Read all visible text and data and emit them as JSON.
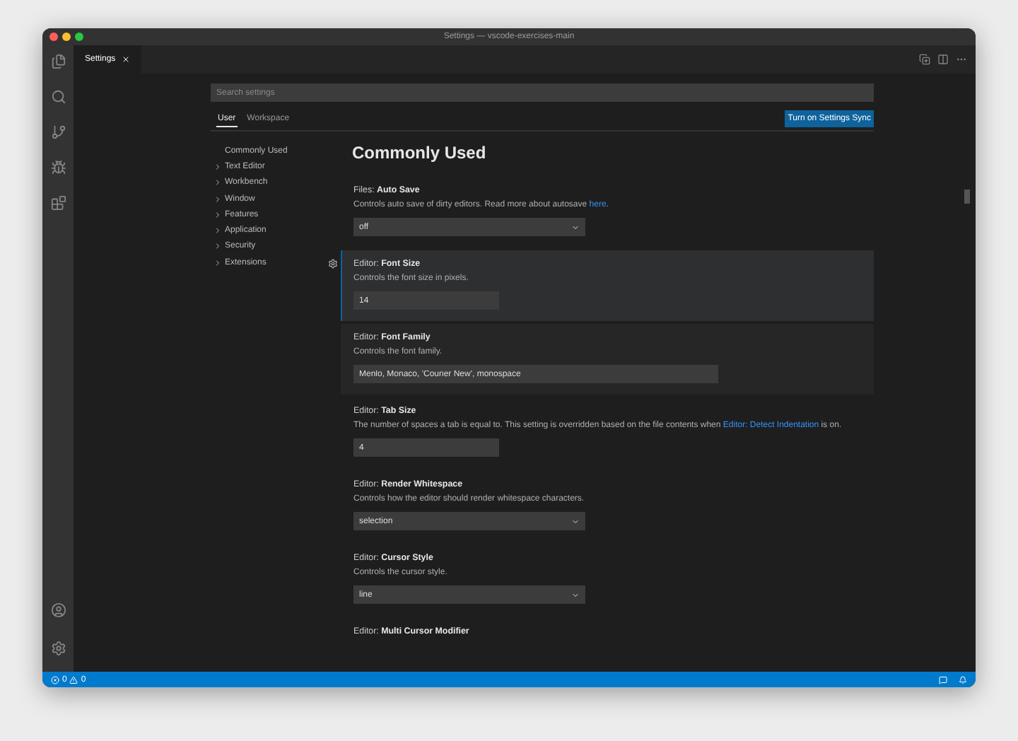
{
  "window": {
    "title": "Settings — vscode-exercises-main"
  },
  "editor_tab": {
    "label": "Settings"
  },
  "search": {
    "placeholder": "Search settings"
  },
  "scope_tabs": [
    {
      "label": "User",
      "selected": true
    },
    {
      "label": "Workspace",
      "selected": false
    }
  ],
  "sync_button": "Turn on Settings Sync",
  "toc": [
    {
      "label": "Commonly Used",
      "kind": "leaf"
    },
    {
      "label": "Text Editor",
      "kind": "group"
    },
    {
      "label": "Workbench",
      "kind": "group"
    },
    {
      "label": "Window",
      "kind": "group"
    },
    {
      "label": "Features",
      "kind": "group"
    },
    {
      "label": "Application",
      "kind": "group"
    },
    {
      "label": "Security",
      "kind": "group"
    },
    {
      "label": "Extensions",
      "kind": "group"
    }
  ],
  "section_title": "Commonly Used",
  "settings": [
    {
      "category": "Files: ",
      "name": "Auto Save",
      "kind": "normal",
      "description": [
        {
          "text": "Controls auto save of dirty editors. Read more about autosave ",
          "link": false
        },
        {
          "text": "here",
          "link": true
        },
        {
          "text": ".",
          "link": false
        }
      ],
      "control": {
        "kind": "select",
        "value": "off"
      }
    },
    {
      "category": "Editor: ",
      "name": "Font Size",
      "kind": "focused",
      "description": [
        {
          "text": "Controls the font size in pixels.",
          "link": false
        }
      ],
      "control": {
        "kind": "text",
        "value": "14"
      }
    },
    {
      "category": "Editor: ",
      "name": "Font Family",
      "kind": "hovered",
      "description": [
        {
          "text": "Controls the font family.",
          "link": false
        }
      ],
      "control": {
        "kind": "wide-text",
        "value": "Menlo, Monaco, 'Courier New', monospace"
      }
    },
    {
      "category": "Editor: ",
      "name": "Tab Size",
      "kind": "normal",
      "description": [
        {
          "text": "The number of spaces a tab is equal to. This setting is overridden based on the file contents when ",
          "link": false
        },
        {
          "text": "Editor: Detect Indentation",
          "link": true
        },
        {
          "text": " is on.",
          "link": false
        }
      ],
      "control": {
        "kind": "text",
        "value": "4"
      }
    },
    {
      "category": "Editor: ",
      "name": "Render Whitespace",
      "kind": "normal",
      "description": [
        {
          "text": "Controls how the editor should render whitespace characters.",
          "link": false
        }
      ],
      "control": {
        "kind": "select",
        "value": "selection"
      }
    },
    {
      "category": "Editor: ",
      "name": "Cursor Style",
      "kind": "normal",
      "description": [
        {
          "text": "Controls the cursor style.",
          "link": false
        }
      ],
      "control": {
        "kind": "select",
        "value": "line"
      }
    },
    {
      "category": "Editor: ",
      "name": "Multi Cursor Modifier",
      "kind": "normal"
    }
  ],
  "status_bar": {
    "errors": "0",
    "warnings": "0"
  }
}
